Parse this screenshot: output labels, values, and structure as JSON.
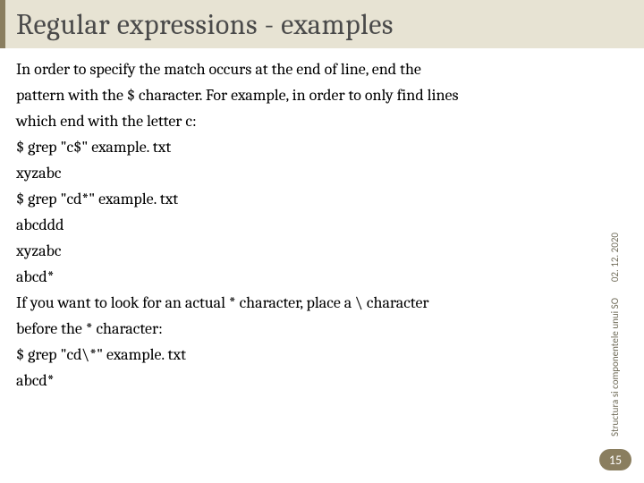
{
  "slide": {
    "title": "Regular expressions - examples",
    "lines": [
      "In order to specify the match occurs at the end of line, end the",
      "pattern with the $ character. For example, in order to only find lines",
      "which end with the letter c:",
      "$ grep \"c$\" example. txt",
      "xyzabc",
      "$ grep \"cd*\" example. txt",
      "abcddd",
      "xyzabc",
      "abcd*",
      "If you want to look for an actual * character, place a \\ character",
      "before the * character:",
      "$ grep \"cd\\*\" example. txt",
      "abcd*"
    ]
  },
  "sidebar": {
    "date": "02. 12. 2020",
    "course": "Structura si componentele unui SO",
    "page_number": "15"
  }
}
